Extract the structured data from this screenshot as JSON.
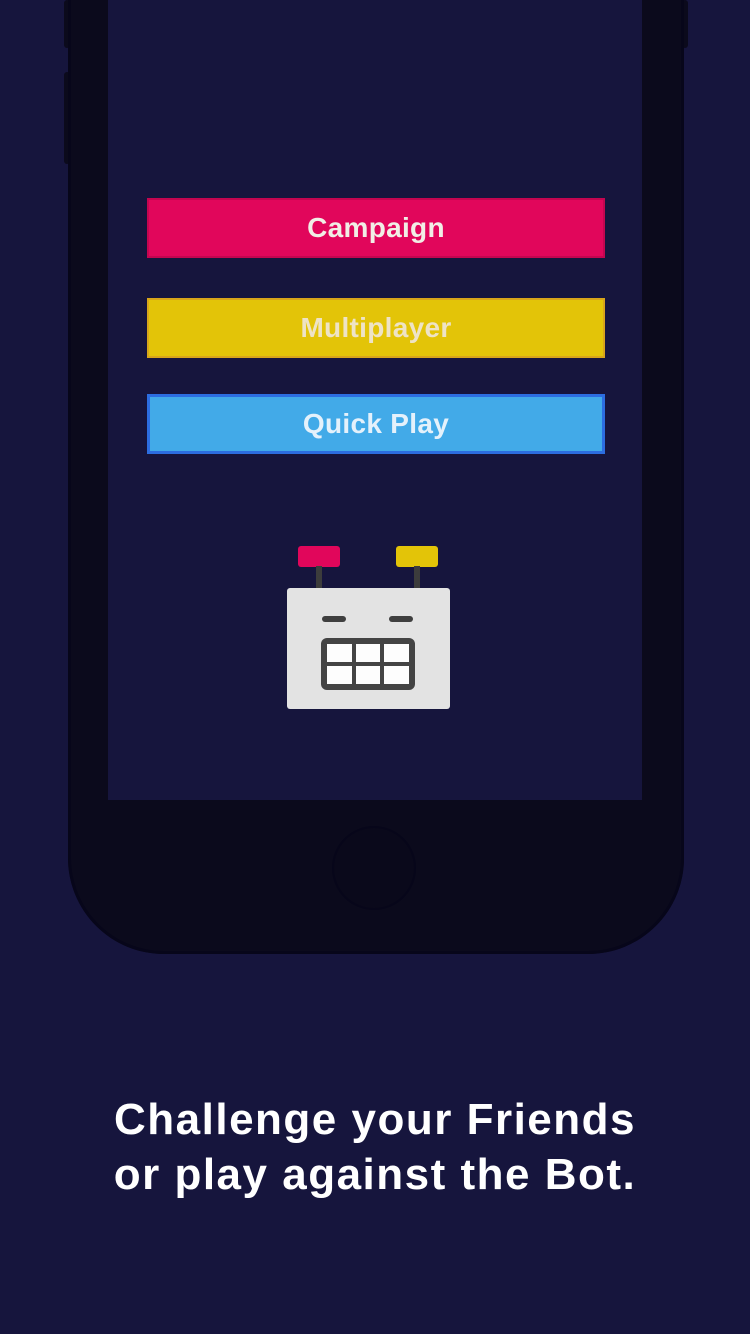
{
  "menu": {
    "campaign_label": "Campaign",
    "multiplayer_label": "Multiplayer",
    "quick_play_label": "Quick Play"
  },
  "caption": {
    "line1": "Challenge your Friends",
    "line2": "or play against the Bot."
  },
  "colors": {
    "background": "#16153d",
    "campaign": "#e1065b",
    "multiplayer": "#e3c408",
    "quick_play": "#42aae8"
  }
}
